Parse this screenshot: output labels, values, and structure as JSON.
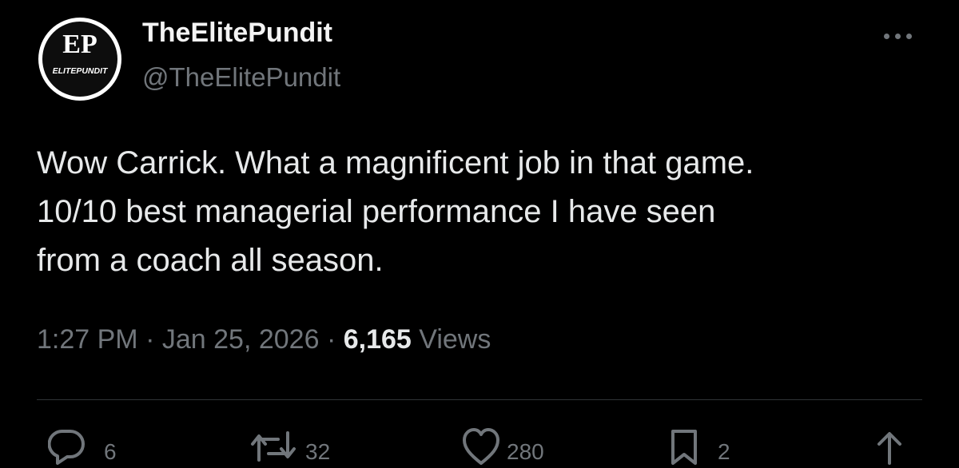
{
  "author": {
    "display_name": "TheElitePundit",
    "handle": "@TheElitePundit",
    "avatar_logo_text": "ELITEPUNDIT",
    "avatar_monogram": "EP"
  },
  "tweet": {
    "lines": [
      "Wow Carrick. What a magnificent job in that game.",
      "10/10 best managerial performance I have seen",
      "from a coach all season."
    ],
    "time": "1:27 PM",
    "separator": "·",
    "date": "Jan 25, 2026",
    "views_count": "6,165",
    "views_label": "Views"
  },
  "actions": {
    "reply": {
      "icon": "reply-icon",
      "count": "6"
    },
    "retweet": {
      "icon": "retweet-icon",
      "count": "32"
    },
    "like": {
      "icon": "heart-icon",
      "count": "280"
    },
    "bookmark": {
      "icon": "bookmark-icon",
      "count": "2"
    },
    "share": {
      "icon": "share-icon"
    }
  },
  "colors": {
    "background": "#000000",
    "text": "#e7e9ea",
    "secondary": "#71767b",
    "divider": "#2f3336"
  }
}
